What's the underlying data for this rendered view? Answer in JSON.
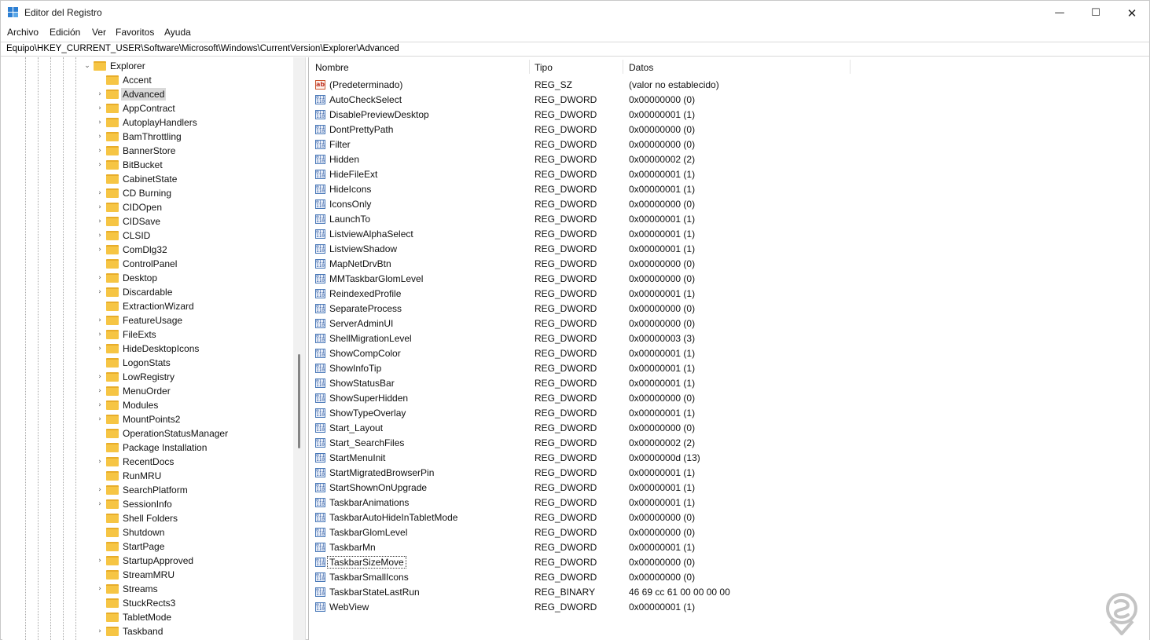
{
  "window": {
    "title": "Editor del Registro",
    "minimize_glyph": "—",
    "maximize_glyph": "☐",
    "close_glyph": "✕"
  },
  "menu": [
    "Archivo",
    "Edición",
    "Ver",
    "Favoritos",
    "Ayuda"
  ],
  "address": "Equipo\\HKEY_CURRENT_USER\\Software\\Microsoft\\Windows\\CurrentVersion\\Explorer\\Advanced",
  "tree": {
    "parent": {
      "label": "Explorer",
      "expanded": true
    },
    "selected": "Advanced",
    "items": [
      {
        "label": "Accent",
        "has_children": false
      },
      {
        "label": "Advanced",
        "has_children": true
      },
      {
        "label": "AppContract",
        "has_children": true
      },
      {
        "label": "AutoplayHandlers",
        "has_children": true
      },
      {
        "label": "BamThrottling",
        "has_children": true
      },
      {
        "label": "BannerStore",
        "has_children": true
      },
      {
        "label": "BitBucket",
        "has_children": true
      },
      {
        "label": "CabinetState",
        "has_children": false
      },
      {
        "label": "CD Burning",
        "has_children": true
      },
      {
        "label": "CIDOpen",
        "has_children": true
      },
      {
        "label": "CIDSave",
        "has_children": true
      },
      {
        "label": "CLSID",
        "has_children": true
      },
      {
        "label": "ComDlg32",
        "has_children": true
      },
      {
        "label": "ControlPanel",
        "has_children": false
      },
      {
        "label": "Desktop",
        "has_children": true
      },
      {
        "label": "Discardable",
        "has_children": true
      },
      {
        "label": "ExtractionWizard",
        "has_children": false
      },
      {
        "label": "FeatureUsage",
        "has_children": true
      },
      {
        "label": "FileExts",
        "has_children": true
      },
      {
        "label": "HideDesktopIcons",
        "has_children": true
      },
      {
        "label": "LogonStats",
        "has_children": false
      },
      {
        "label": "LowRegistry",
        "has_children": true
      },
      {
        "label": "MenuOrder",
        "has_children": true
      },
      {
        "label": "Modules",
        "has_children": true
      },
      {
        "label": "MountPoints2",
        "has_children": true
      },
      {
        "label": "OperationStatusManager",
        "has_children": false
      },
      {
        "label": "Package Installation",
        "has_children": false
      },
      {
        "label": "RecentDocs",
        "has_children": true
      },
      {
        "label": "RunMRU",
        "has_children": false
      },
      {
        "label": "SearchPlatform",
        "has_children": true
      },
      {
        "label": "SessionInfo",
        "has_children": true
      },
      {
        "label": "Shell Folders",
        "has_children": false
      },
      {
        "label": "Shutdown",
        "has_children": false
      },
      {
        "label": "StartPage",
        "has_children": false
      },
      {
        "label": "StartupApproved",
        "has_children": true
      },
      {
        "label": "StreamMRU",
        "has_children": false
      },
      {
        "label": "Streams",
        "has_children": true
      },
      {
        "label": "StuckRects3",
        "has_children": false
      },
      {
        "label": "TabletMode",
        "has_children": false
      },
      {
        "label": "Taskband",
        "has_children": true
      }
    ]
  },
  "list": {
    "columns": {
      "name": "Nombre",
      "type": "Tipo",
      "data": "Datos"
    },
    "focused": "TaskbarSizeMove",
    "rows": [
      {
        "name": "(Predeterminado)",
        "type": "REG_SZ",
        "data": "(valor no establecido)",
        "kind": "string"
      },
      {
        "name": "AutoCheckSelect",
        "type": "REG_DWORD",
        "data": "0x00000000 (0)",
        "kind": "binary"
      },
      {
        "name": "DisablePreviewDesktop",
        "type": "REG_DWORD",
        "data": "0x00000001 (1)",
        "kind": "binary"
      },
      {
        "name": "DontPrettyPath",
        "type": "REG_DWORD",
        "data": "0x00000000 (0)",
        "kind": "binary"
      },
      {
        "name": "Filter",
        "type": "REG_DWORD",
        "data": "0x00000000 (0)",
        "kind": "binary"
      },
      {
        "name": "Hidden",
        "type": "REG_DWORD",
        "data": "0x00000002 (2)",
        "kind": "binary"
      },
      {
        "name": "HideFileExt",
        "type": "REG_DWORD",
        "data": "0x00000001 (1)",
        "kind": "binary"
      },
      {
        "name": "HideIcons",
        "type": "REG_DWORD",
        "data": "0x00000001 (1)",
        "kind": "binary"
      },
      {
        "name": "IconsOnly",
        "type": "REG_DWORD",
        "data": "0x00000000 (0)",
        "kind": "binary"
      },
      {
        "name": "LaunchTo",
        "type": "REG_DWORD",
        "data": "0x00000001 (1)",
        "kind": "binary"
      },
      {
        "name": "ListviewAlphaSelect",
        "type": "REG_DWORD",
        "data": "0x00000001 (1)",
        "kind": "binary"
      },
      {
        "name": "ListviewShadow",
        "type": "REG_DWORD",
        "data": "0x00000001 (1)",
        "kind": "binary"
      },
      {
        "name": "MapNetDrvBtn",
        "type": "REG_DWORD",
        "data": "0x00000000 (0)",
        "kind": "binary"
      },
      {
        "name": "MMTaskbarGlomLevel",
        "type": "REG_DWORD",
        "data": "0x00000000 (0)",
        "kind": "binary"
      },
      {
        "name": "ReindexedProfile",
        "type": "REG_DWORD",
        "data": "0x00000001 (1)",
        "kind": "binary"
      },
      {
        "name": "SeparateProcess",
        "type": "REG_DWORD",
        "data": "0x00000000 (0)",
        "kind": "binary"
      },
      {
        "name": "ServerAdminUI",
        "type": "REG_DWORD",
        "data": "0x00000000 (0)",
        "kind": "binary"
      },
      {
        "name": "ShellMigrationLevel",
        "type": "REG_DWORD",
        "data": "0x00000003 (3)",
        "kind": "binary"
      },
      {
        "name": "ShowCompColor",
        "type": "REG_DWORD",
        "data": "0x00000001 (1)",
        "kind": "binary"
      },
      {
        "name": "ShowInfoTip",
        "type": "REG_DWORD",
        "data": "0x00000001 (1)",
        "kind": "binary"
      },
      {
        "name": "ShowStatusBar",
        "type": "REG_DWORD",
        "data": "0x00000001 (1)",
        "kind": "binary"
      },
      {
        "name": "ShowSuperHidden",
        "type": "REG_DWORD",
        "data": "0x00000000 (0)",
        "kind": "binary"
      },
      {
        "name": "ShowTypeOverlay",
        "type": "REG_DWORD",
        "data": "0x00000001 (1)",
        "kind": "binary"
      },
      {
        "name": "Start_Layout",
        "type": "REG_DWORD",
        "data": "0x00000000 (0)",
        "kind": "binary"
      },
      {
        "name": "Start_SearchFiles",
        "type": "REG_DWORD",
        "data": "0x00000002 (2)",
        "kind": "binary"
      },
      {
        "name": "StartMenuInit",
        "type": "REG_DWORD",
        "data": "0x0000000d (13)",
        "kind": "binary"
      },
      {
        "name": "StartMigratedBrowserPin",
        "type": "REG_DWORD",
        "data": "0x00000001 (1)",
        "kind": "binary"
      },
      {
        "name": "StartShownOnUpgrade",
        "type": "REG_DWORD",
        "data": "0x00000001 (1)",
        "kind": "binary"
      },
      {
        "name": "TaskbarAnimations",
        "type": "REG_DWORD",
        "data": "0x00000001 (1)",
        "kind": "binary"
      },
      {
        "name": "TaskbarAutoHideInTabletMode",
        "type": "REG_DWORD",
        "data": "0x00000000 (0)",
        "kind": "binary"
      },
      {
        "name": "TaskbarGlomLevel",
        "type": "REG_DWORD",
        "data": "0x00000000 (0)",
        "kind": "binary"
      },
      {
        "name": "TaskbarMn",
        "type": "REG_DWORD",
        "data": "0x00000001 (1)",
        "kind": "binary"
      },
      {
        "name": "TaskbarSizeMove",
        "type": "REG_DWORD",
        "data": "0x00000000 (0)",
        "kind": "binary"
      },
      {
        "name": "TaskbarSmallIcons",
        "type": "REG_DWORD",
        "data": "0x00000000 (0)",
        "kind": "binary"
      },
      {
        "name": "TaskbarStateLastRun",
        "type": "REG_BINARY",
        "data": "46 69 cc 61 00 00 00 00",
        "kind": "binary"
      },
      {
        "name": "WebView",
        "type": "REG_DWORD",
        "data": "0x00000001 (1)",
        "kind": "binary"
      }
    ]
  },
  "icons": {
    "app": "registry-editor-icon",
    "folder": "folder-icon",
    "string_value": "string-value-icon",
    "binary_value": "binary-value-icon",
    "watermark": "watermark-logo"
  },
  "colors": {
    "folder": "#f6c544",
    "selection": "#d9d9d9",
    "value_icon": "#4a79b8",
    "string_icon": "#c9552f",
    "watermark": "#b9b9b9"
  }
}
